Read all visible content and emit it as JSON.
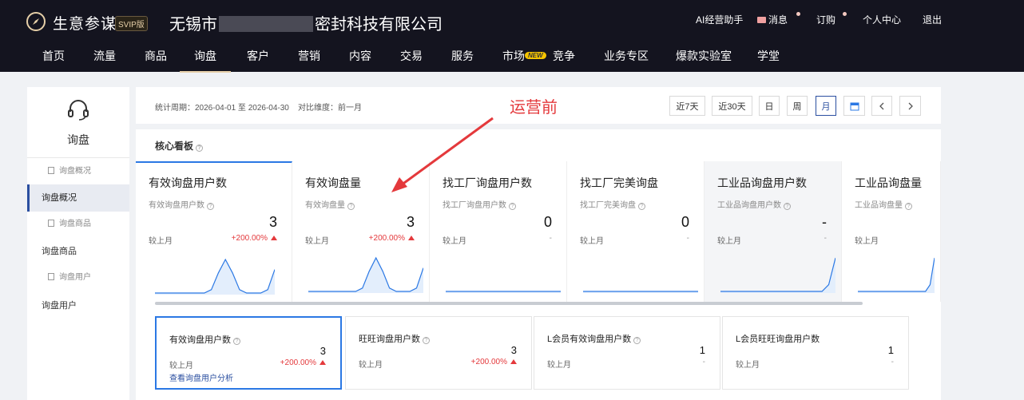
{
  "brand": {
    "name": "生意参谋",
    "badge": "SVIP版"
  },
  "company": {
    "prefix": "无锡市",
    "suffix": "密封科技有限公司"
  },
  "toplinks": {
    "ai": "AI经营助手",
    "msg": "消息",
    "sub": "订购",
    "user": "个人中心",
    "logout": "退出"
  },
  "nav": [
    "首页",
    "流量",
    "商品",
    "询盘",
    "客户",
    "营销",
    "内容",
    "交易",
    "服务",
    "市场",
    "竞争",
    "业务专区",
    "爆款实验室",
    "学堂"
  ],
  "nav_badge": "NEW",
  "sidebar": {
    "title": "询盘",
    "items": [
      {
        "label": "询盘概况",
        "sub": true
      },
      {
        "label": "询盘概况",
        "sub": false,
        "active": true
      },
      {
        "label": "询盘商品",
        "sub": true
      },
      {
        "label": "询盘商品",
        "sub": false
      },
      {
        "label": "询盘用户",
        "sub": true
      },
      {
        "label": "询盘用户",
        "sub": false
      }
    ]
  },
  "period": {
    "text": "统计周期：2026-04-01 至 2026-04-30",
    "compare": "对比维度：前一月",
    "buttons": [
      "近7天",
      "近30天",
      "日",
      "周",
      "月"
    ]
  },
  "annotation": "运营前",
  "panel_title": "核心看板",
  "cards": [
    {
      "title": "有效询盘用户数",
      "sub": "有效询盘用户数",
      "value": "3",
      "cmp": "较上月",
      "change": "+200.00%",
      "up": true,
      "trend": [
        0,
        0,
        0,
        0,
        0,
        0,
        0,
        0,
        0.1,
        0.6,
        1,
        0.6,
        0.1,
        0,
        0,
        0,
        0.1,
        0.7
      ]
    },
    {
      "title": "有效询盘量",
      "sub": "有效询盘量",
      "value": "3",
      "cmp": "较上月",
      "change": "+200.00%",
      "up": true,
      "trend": [
        0,
        0,
        0,
        0,
        0,
        0,
        0,
        0,
        0.1,
        0.6,
        1,
        0.6,
        0.1,
        0,
        0,
        0,
        0.1,
        0.7
      ]
    },
    {
      "title": "找工厂询盘用户数",
      "sub": "找工厂询盘用户数",
      "value": "0",
      "cmp": "较上月",
      "change": "-",
      "up": false,
      "trend": [
        0,
        0,
        0,
        0,
        0,
        0,
        0,
        0,
        0,
        0,
        0,
        0,
        0,
        0,
        0,
        0,
        0,
        0
      ]
    },
    {
      "title": "找工厂完美询盘",
      "sub": "找工厂完美询盘",
      "value": "0",
      "cmp": "较上月",
      "change": "-",
      "up": false,
      "trend": [
        0,
        0,
        0,
        0,
        0,
        0,
        0,
        0,
        0,
        0,
        0,
        0,
        0,
        0,
        0,
        0,
        0,
        0
      ]
    },
    {
      "title": "工业品询盘用户数",
      "sub": "工业品询盘用户数",
      "value": "-",
      "cmp": "较上月",
      "change": "-",
      "up": false,
      "trend": [
        0,
        0,
        0,
        0,
        0,
        0,
        0,
        0,
        0,
        0,
        0,
        0,
        0,
        0,
        0,
        0,
        0.2,
        1
      ]
    },
    {
      "title": "工业品询盘量",
      "sub": "工业品询盘量",
      "value": "",
      "cmp": "较上月",
      "change": "",
      "up": false,
      "trend": [
        0,
        0,
        0,
        0,
        0,
        0,
        0,
        0,
        0,
        0,
        0,
        0,
        0,
        0,
        0,
        0,
        0.2,
        1
      ]
    }
  ],
  "subcards": [
    {
      "title": "有效询盘用户数",
      "value": "3",
      "cmp": "较上月",
      "change": "+200.00%",
      "up": true,
      "link": "查看询盘用户分析"
    },
    {
      "title": "旺旺询盘用户数",
      "value": "3",
      "cmp": "较上月",
      "change": "+200.00%",
      "up": true,
      "link": ""
    },
    {
      "title": "L会员有效询盘用户数",
      "value": "1",
      "cmp": "较上月",
      "change": "-",
      "up": false,
      "link": ""
    },
    {
      "title": "L会员旺旺询盘用户数",
      "value": "1",
      "cmp": "较上月",
      "change": "-",
      "up": false,
      "link": ""
    }
  ],
  "colors": {
    "topbar": "#14141f",
    "accent": "#2b78e4",
    "up": "#e4393c",
    "gold": "#e6cfa8"
  }
}
